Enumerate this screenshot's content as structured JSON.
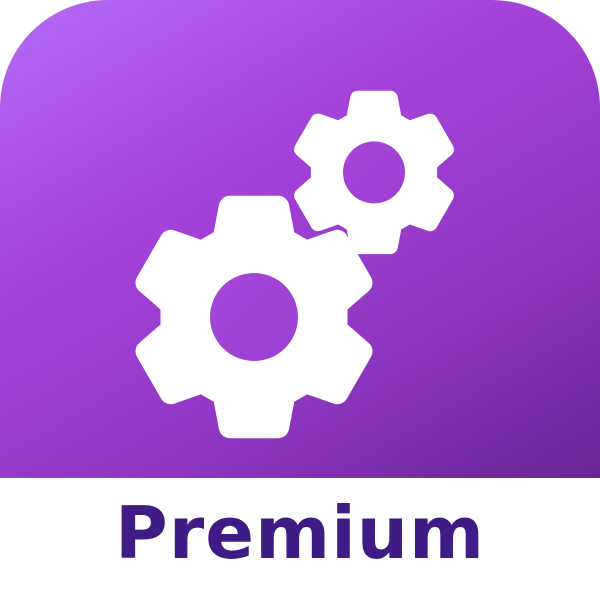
{
  "label": "Premium",
  "icon": "gears-icon",
  "colors": {
    "gradient_start": "#b56af6",
    "gradient_mid": "#a442d9",
    "gradient_end": "#6a2495",
    "gear": "#ffffff",
    "label": "#3f1b86"
  }
}
